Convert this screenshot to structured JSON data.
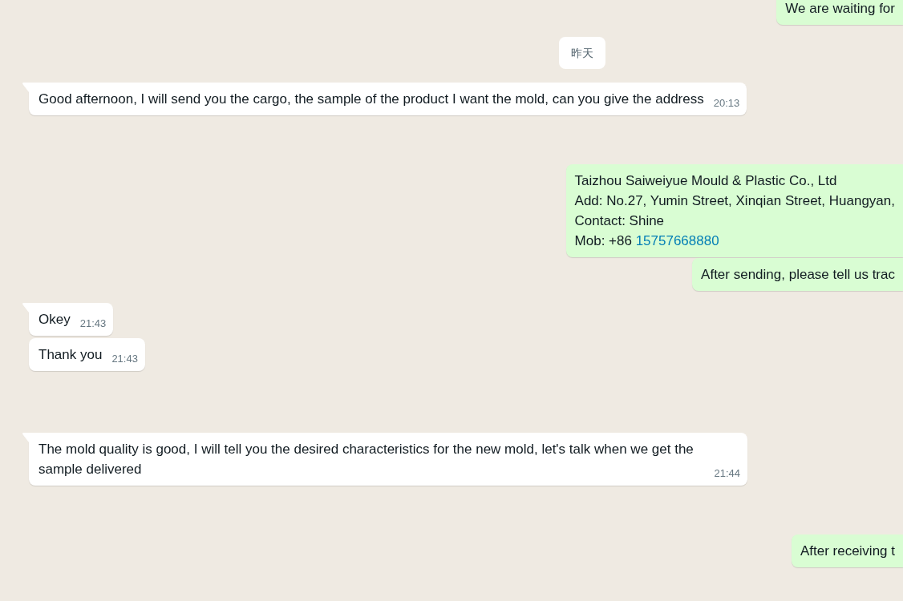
{
  "messages": [
    {
      "kind": "outgoing",
      "lines": [
        {
          "text": "We are waiting for"
        }
      ]
    },
    {
      "kind": "date",
      "text": "昨天"
    },
    {
      "kind": "incoming",
      "tail": true,
      "text": "Good afternoon, I will send you the cargo, the sample of the product I want the mold, can you give the address",
      "time": "20:13"
    },
    {
      "kind": "outgoing",
      "lines": [
        {
          "text": "Taizhou Saiweiyue Mould & Plastic Co., Ltd"
        },
        {
          "text": "Add: No.27, Yumin Street, Xinqian Street, Huangyan,"
        },
        {
          "text": "Contact: Shine"
        },
        {
          "text": "Mob: +86",
          "link": "15757668880"
        }
      ]
    },
    {
      "kind": "outgoing",
      "lines": [
        {
          "text": "After sending, please tell us trac"
        }
      ]
    },
    {
      "kind": "incoming",
      "tail": true,
      "text": "Okey",
      "time": "21:43"
    },
    {
      "kind": "incoming",
      "tail": false,
      "text": "Thank you",
      "time": "21:43"
    },
    {
      "kind": "incoming",
      "tail": true,
      "text": "The mold quality is good, I will tell you the desired characteristics for the new mold, let's talk when we get the sample delivered",
      "time": "21:44"
    },
    {
      "kind": "outgoing",
      "lines": [
        {
          "text": "After receiving t"
        }
      ]
    }
  ]
}
